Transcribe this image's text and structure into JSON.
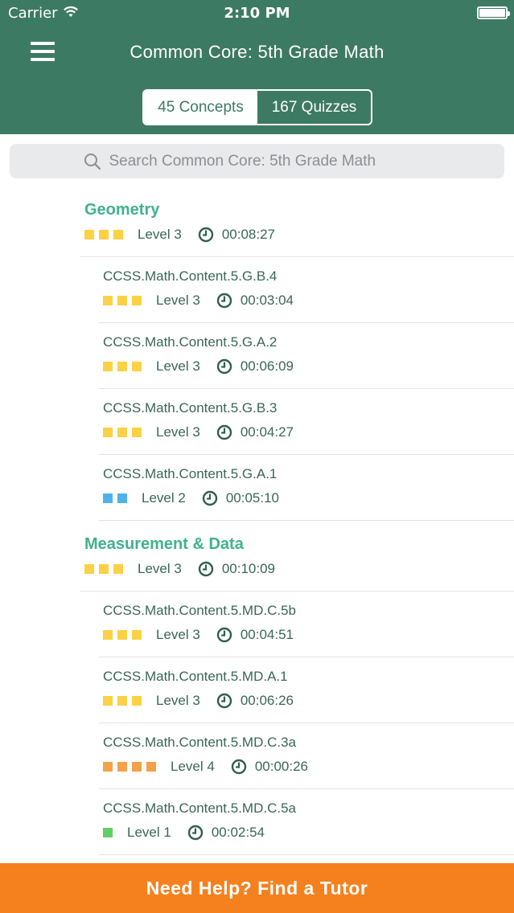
{
  "status_bar": {
    "carrier": "Carrier",
    "time": "2:10 PM"
  },
  "nav": {
    "title": "Common Core: 5th Grade Math"
  },
  "segments": {
    "concepts": "45 Concepts",
    "quizzes": "167 Quizzes",
    "selected": "concepts"
  },
  "search": {
    "placeholder": "Search Common Core: 5th Grade Math"
  },
  "colors": {
    "header": "#3d7a63",
    "accent_green": "#3fb28e",
    "level1": "#5fd066",
    "level2": "#4fb3ea",
    "level3": "#fdd144",
    "level4": "#f5a04a",
    "footer": "#f5811e"
  },
  "categories": [
    {
      "title": "Geometry",
      "level": "Level 3",
      "level_num": 3,
      "time": "00:08:27",
      "items": [
        {
          "title": "CCSS.Math.Content.5.G.B.4",
          "level": "Level 3",
          "level_num": 3,
          "time": "00:03:04"
        },
        {
          "title": "CCSS.Math.Content.5.G.A.2",
          "level": "Level 3",
          "level_num": 3,
          "time": "00:06:09"
        },
        {
          "title": "CCSS.Math.Content.5.G.B.3",
          "level": "Level 3",
          "level_num": 3,
          "time": "00:04:27"
        },
        {
          "title": "CCSS.Math.Content.5.G.A.1",
          "level": "Level 2",
          "level_num": 2,
          "time": "00:05:10"
        }
      ]
    },
    {
      "title": "Measurement & Data",
      "level": "Level 3",
      "level_num": 3,
      "time": "00:10:09",
      "items": [
        {
          "title": "CCSS.Math.Content.5.MD.C.5b",
          "level": "Level 3",
          "level_num": 3,
          "time": "00:04:51"
        },
        {
          "title": "CCSS.Math.Content.5.MD.A.1",
          "level": "Level 3",
          "level_num": 3,
          "time": "00:06:26"
        },
        {
          "title": "CCSS.Math.Content.5.MD.C.3a",
          "level": "Level 4",
          "level_num": 4,
          "time": "00:00:26"
        },
        {
          "title": "CCSS.Math.Content.5.MD.C.5a",
          "level": "Level 1",
          "level_num": 1,
          "time": "00:02:54"
        }
      ]
    }
  ],
  "footer": {
    "label": "Need Help?  Find a Tutor"
  },
  "icons": {
    "menu": "hamburger-icon",
    "search": "search-icon",
    "clock": "clock-icon",
    "wifi": "wifi-icon",
    "battery": "battery-icon"
  }
}
